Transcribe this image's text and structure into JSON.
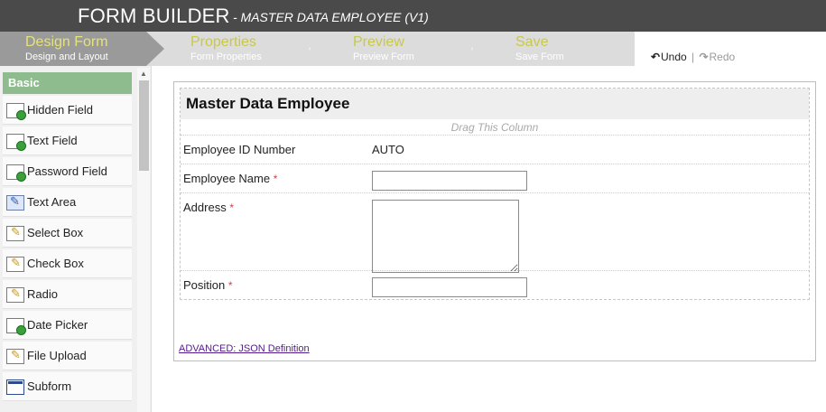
{
  "header": {
    "app_title": "FORM BUILDER",
    "subtitle": "- MASTER DATA EMPLOYEE (V1)"
  },
  "steps": [
    {
      "label": "Design Form",
      "sublabel": "Design and Layout",
      "active": true
    },
    {
      "label": "Properties",
      "sublabel": "Form Properties",
      "active": false
    },
    {
      "label": "Preview",
      "sublabel": "Preview Form",
      "active": false
    },
    {
      "label": "Save",
      "sublabel": "Save Form",
      "active": false
    }
  ],
  "history": {
    "undo_label": "Undo",
    "separator": "|",
    "redo_label": "Redo",
    "undo_icon": "undo-icon",
    "redo_icon": "redo-icon"
  },
  "palette": {
    "category": "Basic",
    "items": [
      {
        "label": "Hidden Field",
        "icon": "text-field-icon"
      },
      {
        "label": "Text Field",
        "icon": "text-field-icon"
      },
      {
        "label": "Password Field",
        "icon": "text-field-icon"
      },
      {
        "label": "Text Area",
        "icon": "text-area-icon"
      },
      {
        "label": "Select Box",
        "icon": "edit-icon"
      },
      {
        "label": "Check Box",
        "icon": "edit-icon"
      },
      {
        "label": "Radio",
        "icon": "edit-icon"
      },
      {
        "label": "Date Picker",
        "icon": "text-field-icon"
      },
      {
        "label": "File Upload",
        "icon": "edit-icon"
      },
      {
        "label": "Subform",
        "icon": "subform-icon"
      }
    ]
  },
  "form": {
    "title": "Master Data Employee",
    "drag_hint": "Drag This Column",
    "required_mark": "*",
    "fields": [
      {
        "label": "Employee ID Number",
        "value": "AUTO",
        "required": false
      },
      {
        "label": "Employee Name",
        "value": "",
        "required": true
      },
      {
        "label": "Address",
        "value": "",
        "required": true
      },
      {
        "label": "Position",
        "value": "",
        "required": true
      }
    ],
    "advanced_link": "ADVANCED: JSON Definition"
  },
  "colors": {
    "header_bg": "#4a4a4a",
    "active_step_bg": "#9a9a9a",
    "step_label": "#c8c84a",
    "palette_category_bg": "#8fbc8f",
    "required": "#e23a3a"
  }
}
